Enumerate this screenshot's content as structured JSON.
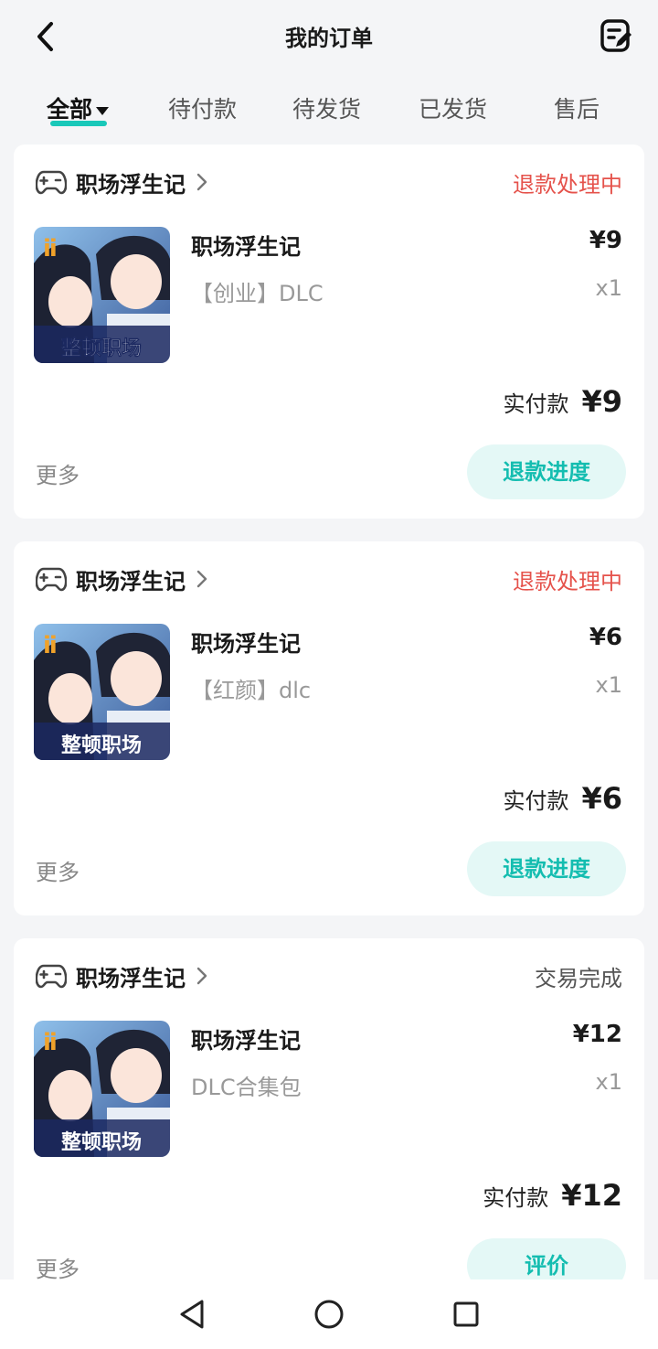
{
  "header": {
    "title": "我的订单",
    "back_icon": "chevron-left-icon",
    "edit_icon": "edit-note-icon"
  },
  "tabs": [
    {
      "label": "全部",
      "active": true
    },
    {
      "label": "待付款",
      "active": false
    },
    {
      "label": "待发货",
      "active": false
    },
    {
      "label": "已发货",
      "active": false
    },
    {
      "label": "售后",
      "active": false
    }
  ],
  "orders": [
    {
      "store": "职场浮生记",
      "status": "退款处理中",
      "product_name": "职场浮生记",
      "sku": "【创业】DLC",
      "price": "¥9",
      "qty": "x1",
      "paid_label": "实付款",
      "paid_value": "¥9",
      "more": "更多",
      "action": "退款进度",
      "thumb_caption": "整顿职场"
    },
    {
      "store": "职场浮生记",
      "status": "退款处理中",
      "product_name": "职场浮生记",
      "sku": "【红颜】dlc",
      "price": "¥6",
      "qty": "x1",
      "paid_label": "实付款",
      "paid_value": "¥6",
      "more": "更多",
      "action": "退款进度",
      "thumb_caption": "整顿职场"
    },
    {
      "store": "职场浮生记",
      "status": "交易完成",
      "product_name": "职场浮生记",
      "sku": "DLC合集包",
      "price": "¥12",
      "qty": "x1",
      "paid_label": "实付款",
      "paid_value": "¥12",
      "more": "更多",
      "action": "评价",
      "thumb_caption": "整顿职场"
    }
  ],
  "colors": {
    "accent": "#19c8b9",
    "refund_status": "#e5524b",
    "action_bg": "#e4f8f6"
  }
}
